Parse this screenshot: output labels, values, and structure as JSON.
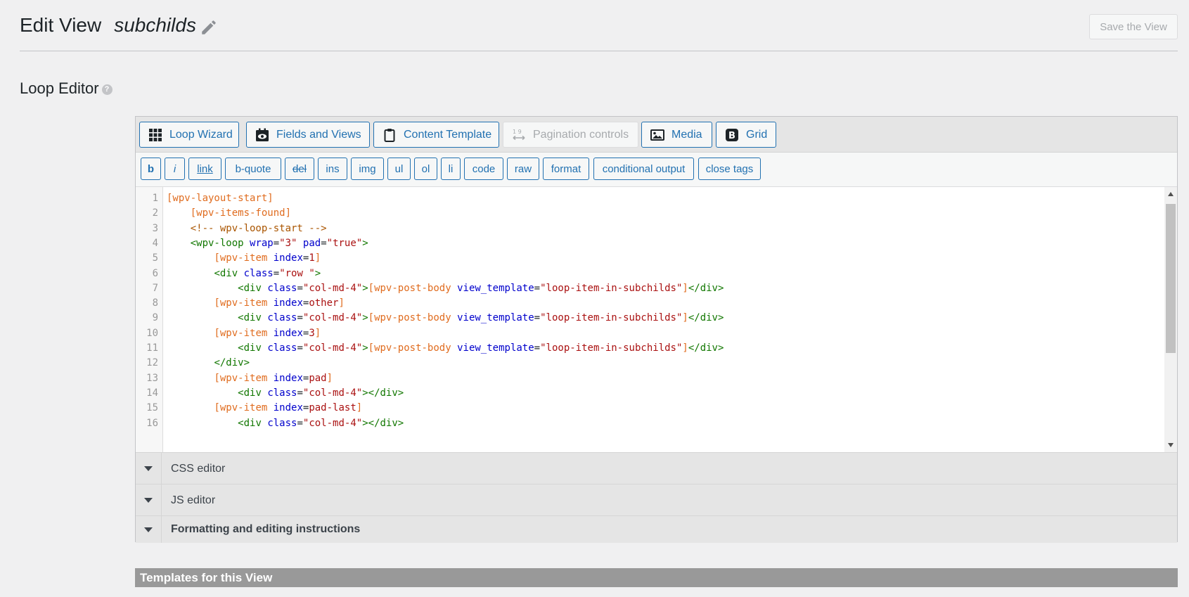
{
  "header": {
    "title": "Edit View",
    "view_name": "subchilds",
    "save_label": "Save the View"
  },
  "section": {
    "title": "Loop Editor",
    "help": "?"
  },
  "tabs": [
    {
      "label": "Loop Wizard",
      "icon": "grid-icon",
      "disabled": false
    },
    {
      "label": "Fields and Views",
      "icon": "calendar-eye-icon",
      "disabled": false
    },
    {
      "label": "Content Template",
      "icon": "clipboard-icon",
      "disabled": false
    },
    {
      "label": "Pagination controls",
      "icon": "pagination-icon",
      "disabled": true
    },
    {
      "label": "Media",
      "icon": "image-icon",
      "disabled": false
    },
    {
      "label": "Grid",
      "icon": "bootstrap-icon",
      "disabled": false
    }
  ],
  "quicktags": [
    "b",
    "i",
    "link",
    "b-quote",
    "del",
    "ins",
    "img",
    "ul",
    "ol",
    "li",
    "code",
    "raw",
    "format",
    "conditional output",
    "close tags"
  ],
  "code_lines": [
    {
      "n": "1",
      "text": "[wpv-layout-start]"
    },
    {
      "n": "2",
      "text": "    [wpv-items-found]"
    },
    {
      "n": "3",
      "text": "    <!-- wpv-loop-start -->"
    },
    {
      "n": "4",
      "text": "    <wpv-loop wrap=\"3\" pad=\"true\">"
    },
    {
      "n": "5",
      "text": "        [wpv-item index=1]"
    },
    {
      "n": "6",
      "text": "        <div class=\"row \">"
    },
    {
      "n": "7",
      "text": "            <div class=\"col-md-4\">[wpv-post-body view_template=\"loop-item-in-subchilds\"]</div>"
    },
    {
      "n": "8",
      "text": "        [wpv-item index=other]"
    },
    {
      "n": "9",
      "text": "            <div class=\"col-md-4\">[wpv-post-body view_template=\"loop-item-in-subchilds\"]</div>"
    },
    {
      "n": "10",
      "text": "        [wpv-item index=3]"
    },
    {
      "n": "11",
      "text": "            <div class=\"col-md-4\">[wpv-post-body view_template=\"loop-item-in-subchilds\"]</div>"
    },
    {
      "n": "12",
      "text": "        </div>"
    },
    {
      "n": "13",
      "text": "        [wpv-item index=pad]"
    },
    {
      "n": "14",
      "text": "            <div class=\"col-md-4\"></div>"
    },
    {
      "n": "15",
      "text": "        [wpv-item index=pad-last]"
    },
    {
      "n": "16",
      "text": "            <div class=\"col-md-4\"></div>"
    }
  ],
  "accordions": [
    {
      "label": "CSS editor",
      "bold": false
    },
    {
      "label": "JS editor",
      "bold": false
    },
    {
      "label": "Formatting and editing instructions",
      "bold": true
    }
  ],
  "templates_bar": {
    "title": "Templates for this View"
  },
  "colors": {
    "accent": "#2271b1",
    "shortcode": "#e06c1f",
    "attribute": "#0000cc",
    "string": "#aa1111",
    "tag": "#117700"
  }
}
